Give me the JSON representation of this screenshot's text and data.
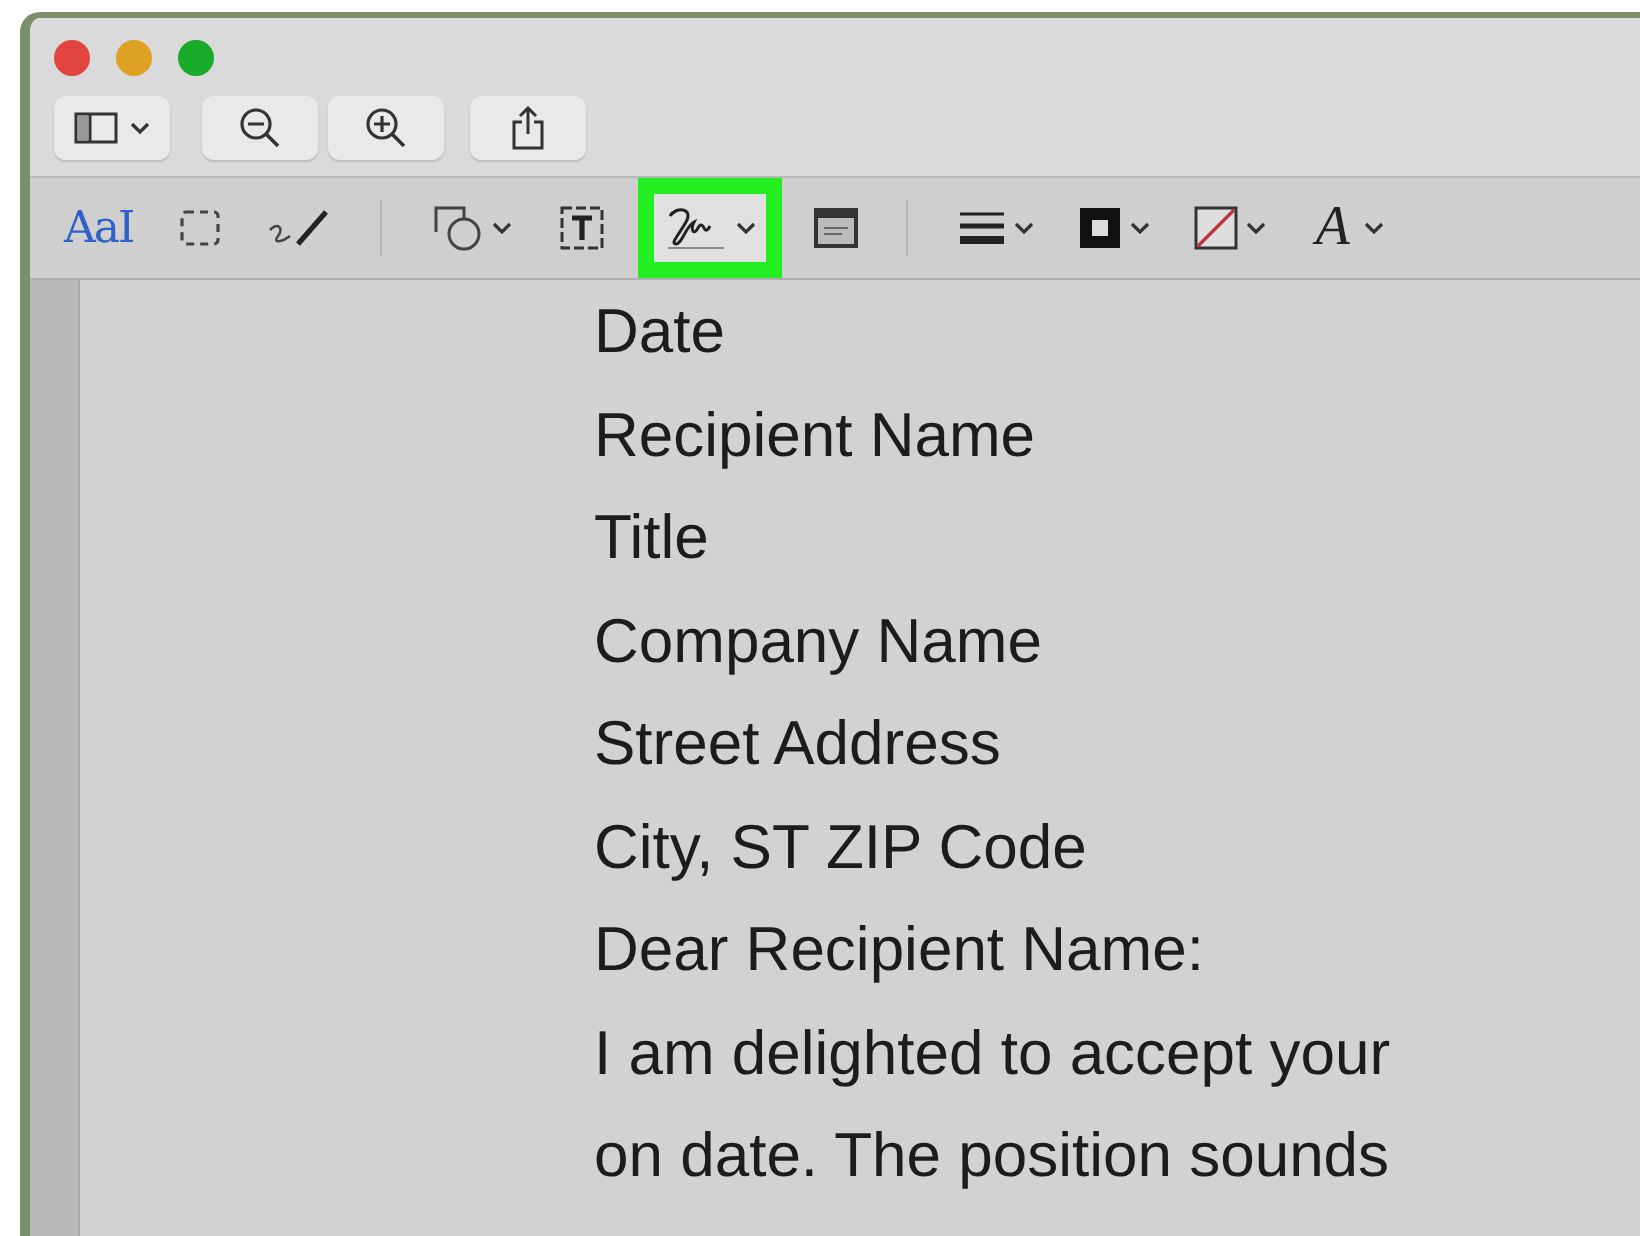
{
  "window": {
    "controls": [
      {
        "kind": "close"
      },
      {
        "kind": "minimize"
      },
      {
        "kind": "zoom"
      }
    ]
  },
  "toolbar": {
    "buttons": [
      {
        "kind": "sidebar",
        "has_menu": true
      },
      {
        "kind": "zoom-out",
        "has_menu": false
      },
      {
        "kind": "zoom-in",
        "has_menu": false
      },
      {
        "kind": "share",
        "has_menu": false
      }
    ]
  },
  "markup_toolbar": {
    "tools": [
      {
        "kind": "text-select",
        "label": "AaI",
        "has_menu": false,
        "highlighted": false
      },
      {
        "kind": "rect-select",
        "has_menu": false,
        "highlighted": false
      },
      {
        "kind": "sketch",
        "has_menu": false,
        "highlighted": false
      },
      {
        "kind": "divider"
      },
      {
        "kind": "shapes",
        "has_menu": true,
        "highlighted": false
      },
      {
        "kind": "text-box",
        "has_menu": false,
        "highlighted": false
      },
      {
        "kind": "signature",
        "has_menu": true,
        "highlighted": true
      },
      {
        "kind": "note",
        "has_menu": false,
        "highlighted": false
      },
      {
        "kind": "divider"
      },
      {
        "kind": "line-style",
        "has_menu": true,
        "highlighted": false
      },
      {
        "kind": "border-color",
        "has_menu": true,
        "highlighted": false
      },
      {
        "kind": "fill-color",
        "has_menu": true,
        "highlighted": false
      },
      {
        "kind": "font",
        "label": "A",
        "has_menu": true,
        "highlighted": false
      }
    ]
  },
  "document": {
    "lines": [
      "Date",
      "Recipient Name",
      "Title",
      "Company Name",
      "Street Address",
      "City, ST ZIP Code",
      "Dear Recipient Name:",
      "I am delighted to accept your",
      "on date. The position sounds"
    ]
  }
}
